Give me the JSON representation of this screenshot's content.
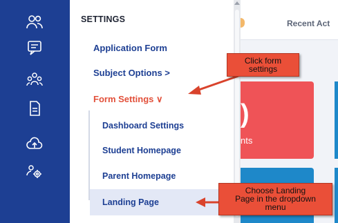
{
  "rail": {
    "icons": [
      "users-icon",
      "chat-icon",
      "group-icon",
      "document-icon",
      "cloud-upload-icon",
      "admin-users-icon"
    ]
  },
  "panel": {
    "title": "SETTINGS",
    "items": [
      {
        "label": "Application Form"
      },
      {
        "label": "Subject Options",
        "suffix": ">"
      },
      {
        "label": "Form Settings",
        "suffix": "∨"
      }
    ],
    "subitems": [
      {
        "label": "Dashboard Settings"
      },
      {
        "label": "Student Homepage"
      },
      {
        "label": "Parent Homepage"
      },
      {
        "label": "Landing Page"
      }
    ]
  },
  "content": {
    "recent_tab": "Recent Act",
    "card_number_fragment": ")",
    "card_label_fragment": "nts"
  },
  "annotations": {
    "callout1": [
      "Click form",
      "settings"
    ],
    "callout2": [
      "Choose Landing",
      "Page in the dropdown",
      "menu"
    ]
  },
  "colors": {
    "rail": "#1d3f93",
    "accent": "#e2503a",
    "link": "#1d3f93",
    "callout": "#ea4f38"
  }
}
